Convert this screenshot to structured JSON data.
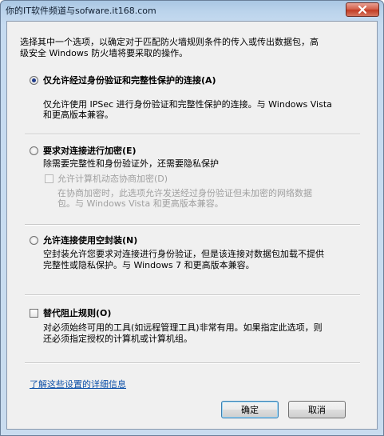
{
  "window": {
    "title": "你的IT软件频道与sofware.it168.com"
  },
  "intro": {
    "line1": "选择其中一个选项，以确定对于匹配防火墙规则条件的传入或传出数据包，高",
    "line2": "级安全 Windows 防火墙将要采取的操作。"
  },
  "options": {
    "auth_secure": {
      "label": "仅允许经过身份验证和完整性保护的连接(A)",
      "desc1": "仅允许使用 IPSec 进行身份验证和完整性保护的连接。与 Windows Vista",
      "desc2": "和更高版本兼容。",
      "selected": true
    },
    "encrypt": {
      "label": "要求对连接进行加密(E)",
      "desc": "除需要完整性和身份验证外，还需要隐私保护",
      "selected": false,
      "sub": {
        "label": "允许计算机动态协商加密(D)",
        "desc1": "在协商加密时，此选项允许发送经过身份验证但未加密的网络数据",
        "desc2": "包。与 Windows Vista 和更高版本兼容。",
        "checked": false,
        "enabled": false
      }
    },
    "null_encap": {
      "label": "允许连接使用空封装(N)",
      "desc1": "空封装允许您要求对连接进行身份验证，但是该连接对数据包加载不提供",
      "desc2": "完整性或隐私保护。与 Windows 7 和更高版本兼容。",
      "selected": false
    },
    "override": {
      "label": "替代阻止规则(O)",
      "desc1": "对必须始终可用的工具(如远程管理工具)非常有用。如果指定此选项，则",
      "desc2": "还必须指定授权的计算机或计算机组。",
      "checked": false
    }
  },
  "link": {
    "text": "了解这些设置的详细信息"
  },
  "buttons": {
    "ok": "确定",
    "cancel": "取消"
  },
  "colors": {
    "link": "#0b4fa8",
    "close": "#c23d25",
    "selected_dot": "#1f3b8a"
  }
}
